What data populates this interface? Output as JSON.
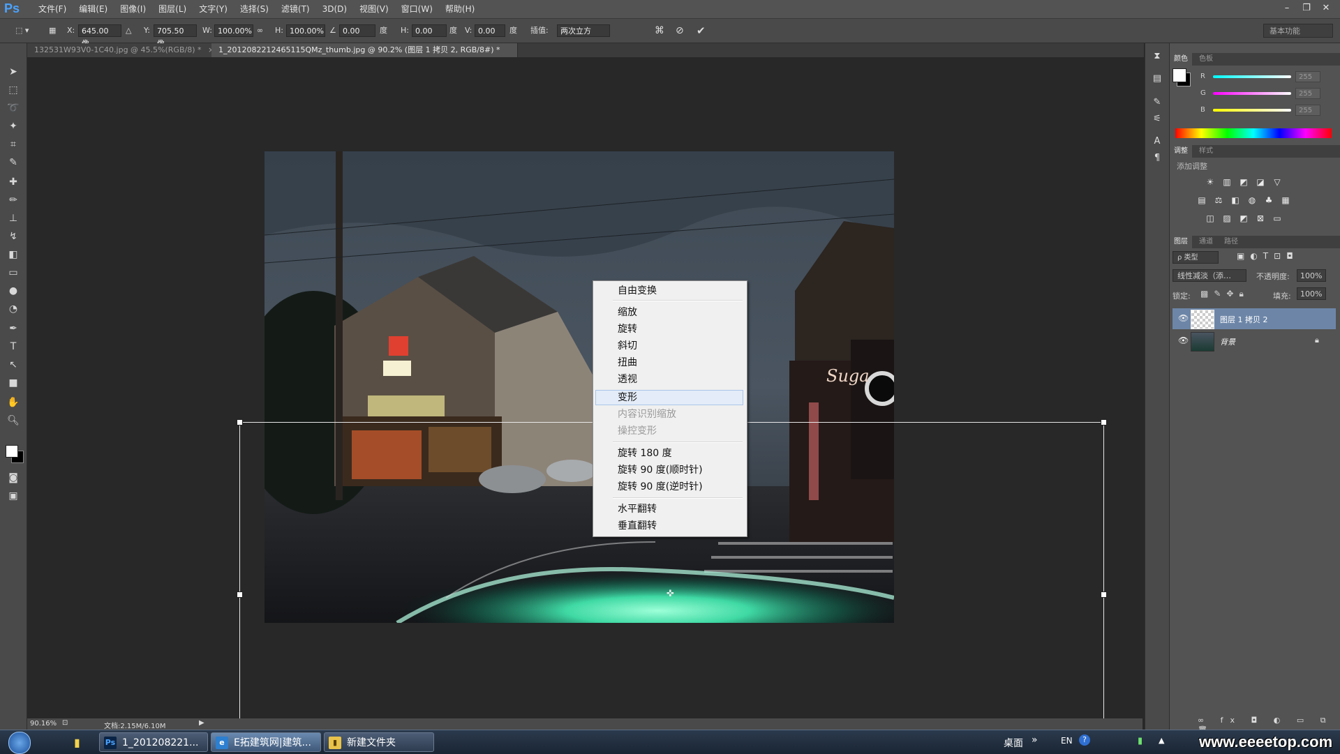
{
  "app": {
    "logo": "Ps"
  },
  "menu": [
    "文件(F)",
    "编辑(E)",
    "图像(I)",
    "图层(L)",
    "文字(Y)",
    "选择(S)",
    "滤镜(T)",
    "3D(D)",
    "视图(V)",
    "窗口(W)",
    "帮助(H)"
  ],
  "options": {
    "x_label": "X:",
    "x_value": "645.00 像",
    "y_label": "Y:",
    "y_value": "705.50 像",
    "w_label": "W:",
    "w_value": "100.00%",
    "h_label": "H:",
    "h_value": "100.00%",
    "angle_value": "0.00",
    "angle_unit": "度",
    "hskew_label": "H:",
    "hskew_value": "0.00",
    "hskew_unit": "度",
    "vskew_label": "V:",
    "vskew_value": "0.00",
    "vskew_unit": "度",
    "interp_label": "插值:",
    "interp_value": "两次立方",
    "workspace": "基本功能"
  },
  "tabs": [
    {
      "label": "132531W93V0-1C40.jpg @ 45.5%(RGB/8) *",
      "close": "×"
    },
    {
      "label": "1_2012082212465115QMz_thumb.jpg @ 90.2% (图层 1 拷贝 2, RGB/8#) *",
      "close": "×"
    }
  ],
  "context_menu": {
    "items": [
      "自由变换",
      "缩放",
      "旋转",
      "斜切",
      "扭曲",
      "透视",
      "变形",
      "内容识别缩放",
      "操控变形",
      "旋转 180 度",
      "旋转 90 度(顺时针)",
      "旋转 90 度(逆时针)",
      "水平翻转",
      "垂直翻转"
    ],
    "highlighted": "变形"
  },
  "photo": {
    "sign_text": "Suga"
  },
  "status": {
    "zoom": "90.16%",
    "doc": "文档:2.15M/6.10M"
  },
  "color_panel": {
    "tabs": [
      "颜色",
      "色板"
    ],
    "r_label": "R",
    "g_label": "G",
    "b_label": "B",
    "r": "255",
    "g": "255",
    "b": "255"
  },
  "adjust_panel": {
    "tabs": [
      "调整",
      "样式"
    ],
    "title": "添加调整"
  },
  "layers_panel": {
    "tabs": [
      "图层",
      "通道",
      "路径"
    ],
    "kind": "ρ 类型",
    "blend": "线性减淡（添…",
    "opacity_label": "不透明度:",
    "opacity": "100%",
    "lock_label": "锁定:",
    "fill_label": "填充:",
    "fill": "100%",
    "layers": [
      {
        "name": "图层 1 拷贝 2",
        "selected": true
      },
      {
        "name": "背景",
        "selected": false
      }
    ]
  },
  "taskbar": {
    "buttons": [
      "1_201208221...",
      "E拓建筑网|建筑...",
      "新建文件夹"
    ],
    "tray_desktop": "桌面",
    "tray_lang": "EN",
    "watermark": "www.eeeetop.com"
  },
  "colors": {
    "accent": "#4aa3ff",
    "selection": "#6d86a8",
    "menu_highlight": "#e3ecf8"
  }
}
